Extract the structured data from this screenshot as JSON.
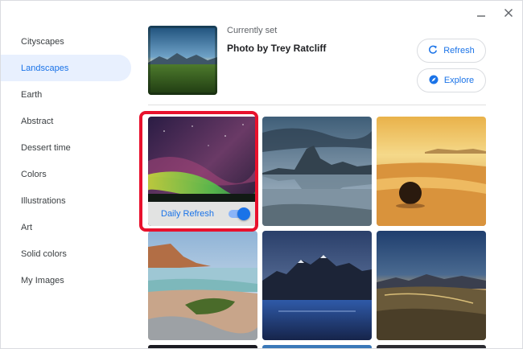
{
  "window": {
    "minimize_icon": "minimize-icon",
    "close_icon": "close-icon"
  },
  "sidebar": {
    "items": [
      {
        "label": "Cityscapes"
      },
      {
        "label": "Landscapes",
        "active": true
      },
      {
        "label": "Earth"
      },
      {
        "label": "Abstract"
      },
      {
        "label": "Dessert time"
      },
      {
        "label": "Colors"
      },
      {
        "label": "Illustrations"
      },
      {
        "label": "Art"
      },
      {
        "label": "Solid colors"
      },
      {
        "label": "My Images"
      }
    ]
  },
  "current": {
    "label": "Currently set",
    "title": "Photo by Trey Ratcliff"
  },
  "buttons": {
    "refresh_label": "Refresh",
    "refresh_icon": "refresh-icon",
    "explore_label": "Explore",
    "explore_icon": "compass-icon"
  },
  "grid": {
    "daily_refresh_label": "Daily Refresh",
    "daily_refresh_enabled": true
  },
  "colors": {
    "accent": "#1a73e8",
    "highlight": "#e8112d",
    "active_bg": "#e8f0fe"
  }
}
